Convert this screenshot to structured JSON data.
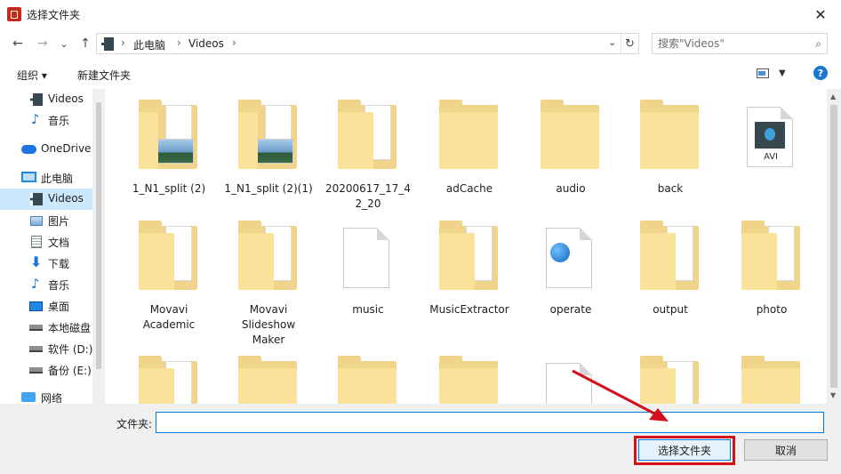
{
  "window": {
    "title": "选择文件夹",
    "close_glyph": "✕"
  },
  "nav": {
    "back_glyph": "←",
    "forward_glyph": "→",
    "recent_glyph": "⌄",
    "up_glyph": "↑",
    "breadcrumb": [
      "此电脑",
      "Videos"
    ],
    "separator": "›",
    "dropdown_glyph": "⌄",
    "refresh_glyph": "↻"
  },
  "search": {
    "placeholder": "搜索\"Videos\"",
    "icon": "search-icon"
  },
  "toolbar": {
    "organize": "组织 ▾",
    "new_folder": "新建文件夹",
    "help_glyph": "?"
  },
  "sidebar": {
    "items": [
      {
        "label": "Videos",
        "icon": "video-folder-icon",
        "selected": false
      },
      {
        "label": "音乐",
        "icon": "music-icon",
        "selected": false
      },
      {
        "label": "OneDrive",
        "icon": "cloud-icon",
        "selected": false
      },
      {
        "label": "此电脑",
        "icon": "computer-icon",
        "selected": false
      },
      {
        "label": "Videos",
        "icon": "video-folder-icon",
        "selected": true
      },
      {
        "label": "图片",
        "icon": "pictures-icon",
        "selected": false
      },
      {
        "label": "文档",
        "icon": "documents-icon",
        "selected": false
      },
      {
        "label": "下载",
        "icon": "download-icon",
        "selected": false
      },
      {
        "label": "音乐",
        "icon": "music-icon",
        "selected": false
      },
      {
        "label": "桌面",
        "icon": "desktop-icon",
        "selected": false
      },
      {
        "label": "本地磁盘",
        "icon": "drive-icon",
        "selected": false
      },
      {
        "label": "软件 (D:)",
        "icon": "drive-icon",
        "selected": false
      },
      {
        "label": "备份 (E:)",
        "icon": "drive-icon",
        "selected": false
      },
      {
        "label": "网络",
        "icon": "network-icon",
        "selected": false
      }
    ]
  },
  "files": {
    "row1": [
      {
        "name": "1_N1_split (2)",
        "kind": "folder-photo"
      },
      {
        "name": "1_N1_split (2)(1)",
        "kind": "folder-photo"
      },
      {
        "name": "20200617_17_4\n2_20",
        "kind": "folder-doc"
      },
      {
        "name": "adCache",
        "kind": "folder"
      },
      {
        "name": "audio",
        "kind": "folder"
      },
      {
        "name": "back",
        "kind": "folder"
      },
      {
        "name": "",
        "kind": "avi-file",
        "badge": "AVI"
      }
    ],
    "row2": [
      {
        "name": "Movavi\nAcademic",
        "kind": "folder-doc"
      },
      {
        "name": "Movavi\nSlideshow\nMaker",
        "kind": "folder-doc"
      },
      {
        "name": "music",
        "kind": "file"
      },
      {
        "name": "MusicExtractor",
        "kind": "folder-doc"
      },
      {
        "name": "operate",
        "kind": "globe-file"
      },
      {
        "name": "output",
        "kind": "folder-doc"
      },
      {
        "name": "photo",
        "kind": "folder-white"
      }
    ],
    "row3": [
      {
        "name": "",
        "kind": "folder-doc"
      },
      {
        "name": "",
        "kind": "folder"
      },
      {
        "name": "",
        "kind": "folder"
      },
      {
        "name": "",
        "kind": "folder"
      },
      {
        "name": "",
        "kind": "file"
      },
      {
        "name": "",
        "kind": "file"
      },
      {
        "name": "",
        "kind": "folder"
      }
    ]
  },
  "bottom": {
    "folder_label": "文件夹:",
    "folder_value": "",
    "select_button": "选择文件夹",
    "cancel_button": "取消"
  },
  "colors": {
    "accent": "#0078d7",
    "selection": "#cce8ff",
    "annotation": "#d4101a"
  }
}
